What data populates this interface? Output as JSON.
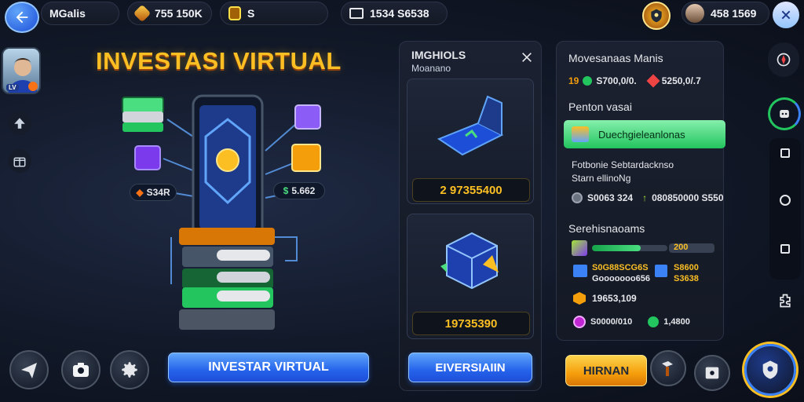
{
  "header": {
    "player_name": "MGalis",
    "gold_value": "755 150K",
    "token_value": "S",
    "cash_value": "1534 S6538",
    "profile_value": "458 1569"
  },
  "hero": {
    "title": "INVESTASI VIRTUAL",
    "left_tag": "S34R",
    "right_tag": "5.662",
    "invest_button": "INVESTAR VIRTUAL"
  },
  "middle_panel": {
    "title": "IMGHIOLS",
    "subtitle": "Moanano",
    "card1_value": "2 97355400",
    "card2_value": "19735390",
    "button": "EIVERSIAIIN"
  },
  "right_panel": {
    "title": "Movesanaas Manis",
    "stat1_label": "19",
    "stat1_value": "S700,0/0.",
    "stat2_value": "5250,0/.7",
    "section1": "Penton vasai",
    "green_bar_label": "Duechgieleanlonas",
    "info_line1": "Fotbonie Sebtardacknso",
    "info_line2": "Starn ellinoNg",
    "row_a_left": "S0063 324",
    "row_a_right": "080850000 S550",
    "section2": "Serehisnaoams",
    "progress_value": "200",
    "progress_fraction": 0.65,
    "row_b_left1": "S0G88SCG6S",
    "row_b_left2": "Gooooooo656",
    "row_b_right1": "S8600",
    "row_b_right2": "S3638",
    "row_c": "19653,109",
    "row_d_left": "S0000/010",
    "row_d_right": "1,4800",
    "button": "HIRNAN"
  },
  "colors": {
    "accent_gold": "#fbbf24",
    "accent_blue": "#2563eb",
    "accent_green": "#4ade80",
    "accent_orange": "#f59e0b"
  }
}
